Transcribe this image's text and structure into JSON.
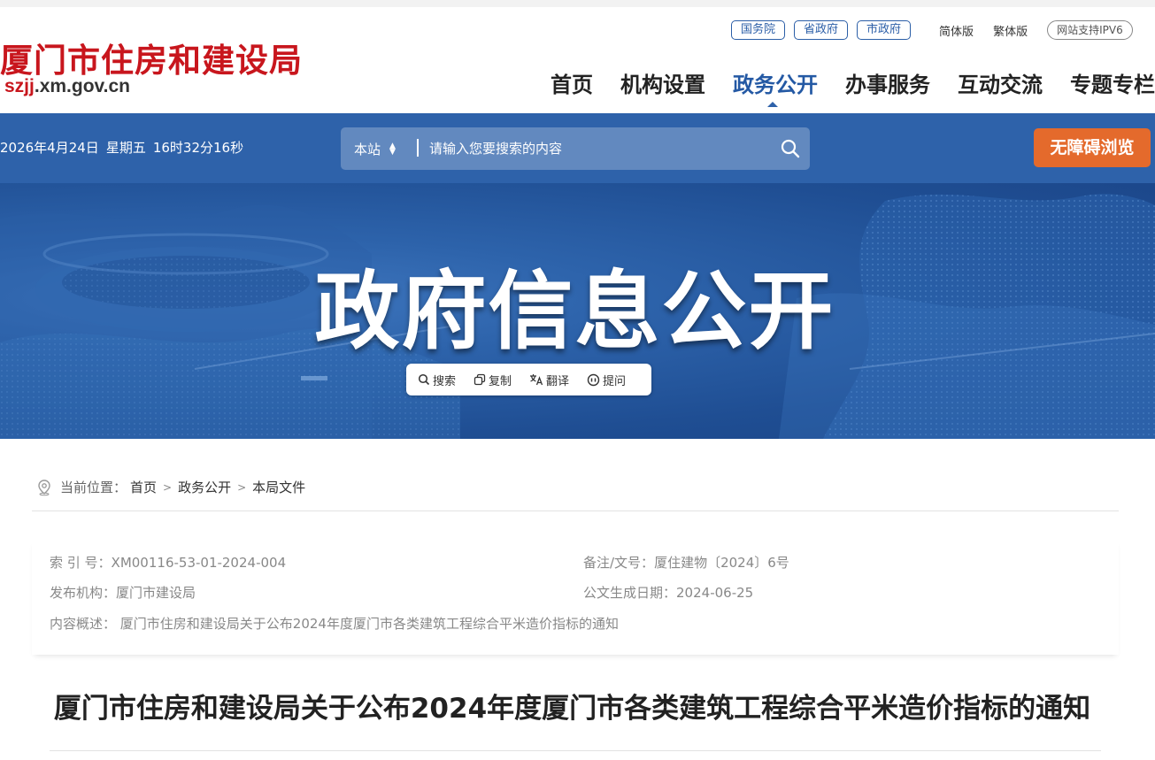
{
  "header": {
    "site_title": "厦门市住房和建设局",
    "domain_prefix": "szjj",
    "domain_suffix": ".xm.gov.cn",
    "top_links": [
      "国务院",
      "省政府",
      "市政府"
    ],
    "lang_simplified": "简体版",
    "lang_traditional": "繁体版",
    "ipv6_badge": "网站支持IPV6",
    "nav": [
      "首页",
      "机构设置",
      "政务公开",
      "办事服务",
      "互动交流",
      "专题专栏"
    ],
    "active_nav": "政务公开"
  },
  "bar": {
    "date": "2026年4月24日",
    "weekday": "星期五",
    "time": "16时32分16秒",
    "search_scope": "本站",
    "search_placeholder": "请输入您要搜索的内容",
    "accessibility_label": "无障碍浏览"
  },
  "banner": {
    "title": "政府信息公开",
    "tools": [
      "搜索",
      "复制",
      "翻译",
      "提问"
    ]
  },
  "breadcrumb": {
    "label": "当前位置：",
    "items": [
      "首页",
      "政务公开",
      "本局文件"
    ]
  },
  "meta": {
    "index_label": "索 引 号：",
    "index_value": "XM00116-53-01-2024-004",
    "docno_label": "备注/文号：",
    "docno_value": "厦住建物〔2024〕6号",
    "publisher_label": "发布机构：",
    "publisher_value": "厦门市建设局",
    "date_label": "公文生成日期：",
    "date_value": "2024-06-25",
    "summary_label": "内容概述：",
    "summary_value": "厦门市住房和建设局关于公布2024年度厦门市各类建筑工程综合平米造价指标的通知"
  },
  "document": {
    "title": "厦门市住房和建设局关于公布2024年度厦门市各类建筑工程综合平米造价指标的通知"
  },
  "colors": {
    "brand_red": "#c8161d",
    "primary_blue": "#2e62aa",
    "accent_orange": "#e46a2c"
  }
}
